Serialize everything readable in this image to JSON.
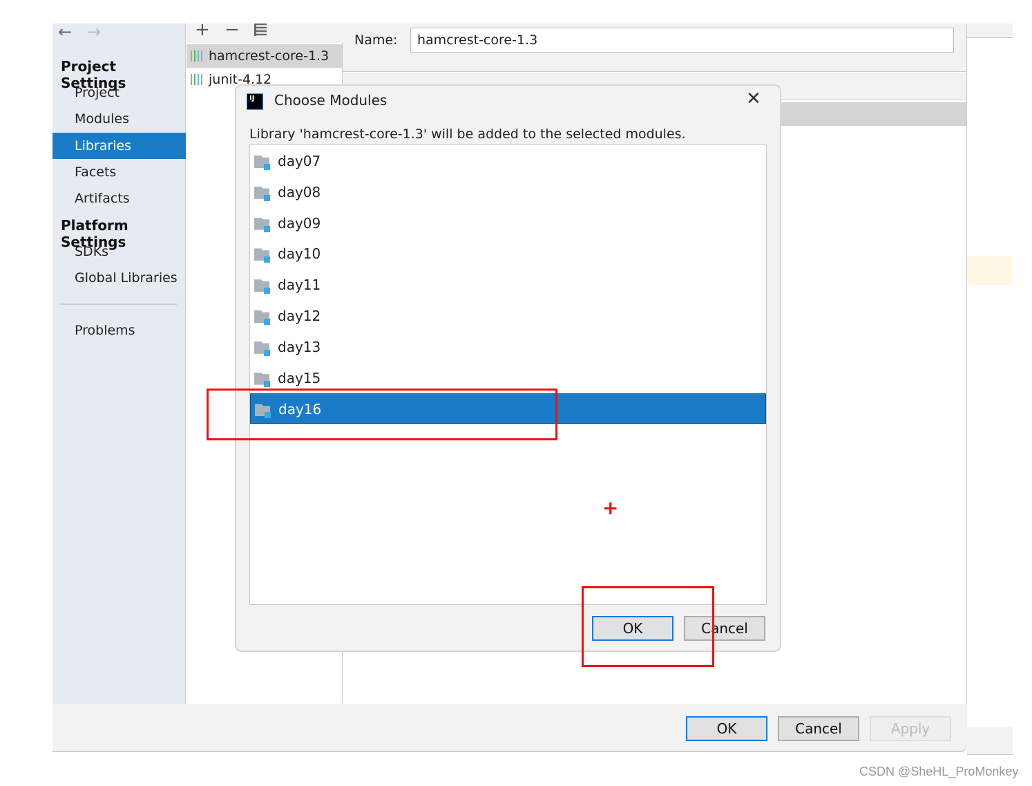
{
  "sidebar": {
    "project_settings": "Project Settings",
    "items": [
      "Project",
      "Modules",
      "Libraries",
      "Facets",
      "Artifacts"
    ],
    "platform_settings": "Platform Settings",
    "platform_items": [
      "SDKs",
      "Global Libraries"
    ],
    "problems": "Problems"
  },
  "libraries": [
    "hamcrest-core-1.3",
    "junit-4.12"
  ],
  "detail": {
    "name_label": "Name:",
    "name_value": "hamcrest-core-1.3"
  },
  "dialog": {
    "title": "Choose Modules",
    "message": "Library 'hamcrest-core-1.3' will be added to the selected modules.",
    "modules": [
      "day07",
      "day08",
      "day09",
      "day10",
      "day11",
      "day12",
      "day13",
      "day15",
      "day16"
    ],
    "selected": "day16",
    "ok": "OK",
    "cancel": "Cancel"
  },
  "footer": {
    "ok": "OK",
    "cancel": "Cancel",
    "apply": "Apply"
  },
  "watermark": "CSDN @SheHL_ProMonkey",
  "colors": {
    "selection": "#1a7cc6",
    "annotation": "#ee1111"
  }
}
